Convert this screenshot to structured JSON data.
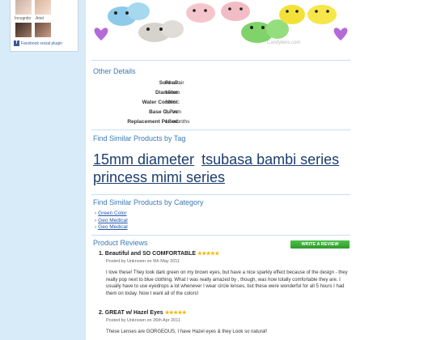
{
  "sidebar": {
    "friends": [
      {
        "name": "Incognito"
      },
      {
        "name": "Ariel"
      }
    ],
    "fb_plugin_label": "Facebook social plugin"
  },
  "product": {
    "watermark": "Candylens.com"
  },
  "details": {
    "heading": "Other Details",
    "rows": [
      {
        "label": "Sold as:",
        "value": "Per Pair"
      },
      {
        "label": "Diameter:",
        "value": "15mm"
      },
      {
        "label": "Water Content:",
        "value": "38%"
      },
      {
        "label": "Base Curve:",
        "value": "8.7mm"
      },
      {
        "label": "Replacement Period:",
        "value": "12 months"
      }
    ]
  },
  "tags": {
    "heading": "Find Similar Products by Tag",
    "items": [
      "15mm diameter",
      "tsubasa bambi series",
      "princess mimi series"
    ]
  },
  "categories": {
    "heading": "Find Similar Products by Category",
    "items": [
      "Green Color",
      "Geo Medical",
      "Geo Medical"
    ]
  },
  "reviews": {
    "heading": "Product Reviews",
    "write_button": "WRITE A REVIEW",
    "items": [
      {
        "number": "1.",
        "title": "Beautiful and SO COMFORTABLE",
        "stars": "★★★★★",
        "posted": "Posted by Unknown on 5th May 2011",
        "body": "I love these! They look dark green on my brown eyes, but have a nice sparkly effect because of the design - they really pop next to blue clothing. What I was really amazed by , though, was how totally comfortable they are. I usually have to use eyedrops a lot whenever I wear circle lenses, but these were wonderful for all 5 hours I had them on today. Now I want all of the colors!"
      },
      {
        "number": "2.",
        "title": "GREAT w/ Hazel Eyes",
        "stars": "★★★★★",
        "posted": "Posted by Unknown on 26th Apr 2011",
        "body": "These Lenses are GORGEOUS, I have Hazel eyes & they Look so natural!"
      }
    ]
  },
  "colors": {
    "accent": "#3a7ab7",
    "sidebar_bg": "#d7ecf8",
    "button_green": "#3aaa36",
    "star": "#f2b705"
  }
}
